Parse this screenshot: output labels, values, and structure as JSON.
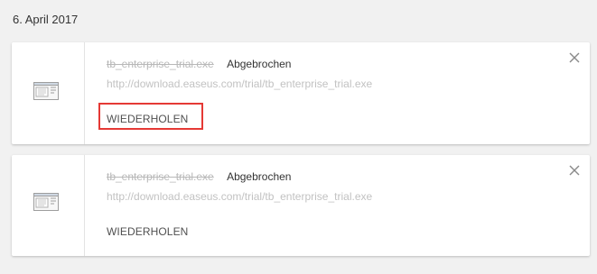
{
  "date_header": "6. April 2017",
  "downloads": [
    {
      "file_name": "tb_enterprise_trial.exe",
      "status": "Abgebrochen",
      "url": "http://download.easeus.com/trial/tb_enterprise_trial.exe",
      "retry_label": "WIEDERHOLEN"
    },
    {
      "file_name": "tb_enterprise_trial.exe",
      "status": "Abgebrochen",
      "url": "http://download.easeus.com/trial/tb_enterprise_trial.exe",
      "retry_label": "WIEDERHOLEN"
    }
  ],
  "colors": {
    "highlight": "#e53935",
    "background": "#f1f1f1"
  },
  "icons": {
    "file": "file-icon",
    "close": "close-icon"
  }
}
